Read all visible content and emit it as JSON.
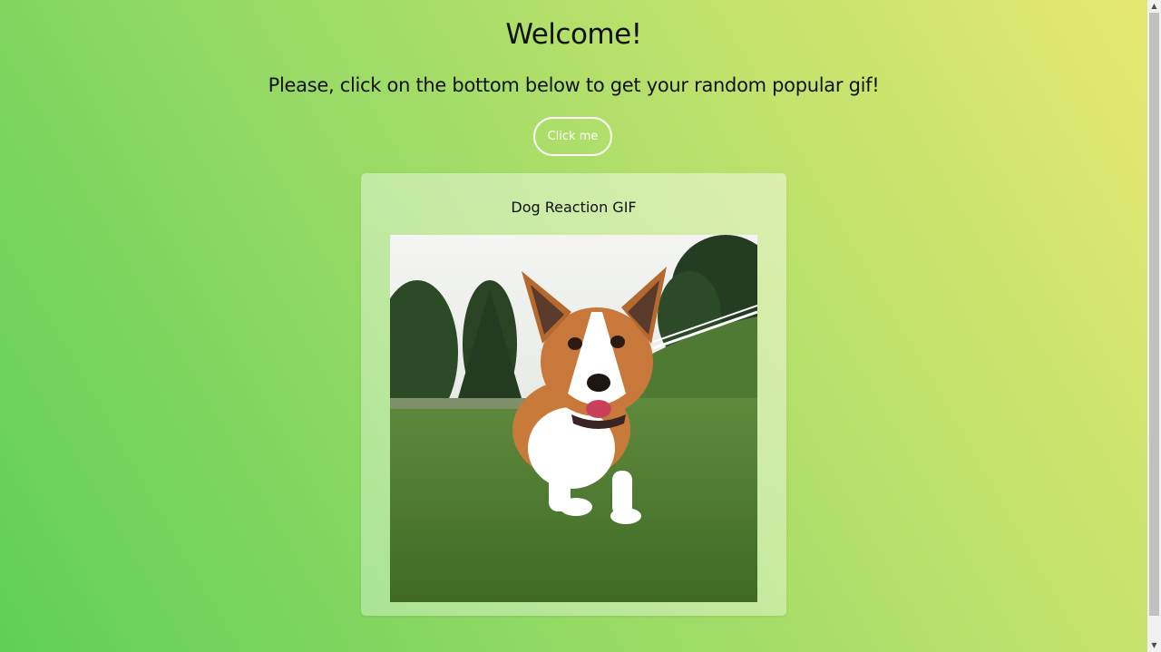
{
  "page": {
    "heading": "Welcome!",
    "subtitle": "Please, click on the bottom below to get your random popular gif!",
    "button_label": "Click me"
  },
  "gif_card": {
    "title": "Dog Reaction GIF",
    "image_subject": "corgi dog running on grass"
  },
  "scrollbar": {
    "up_icon": "▲",
    "down_icon": "▼"
  },
  "colors": {
    "gradient_start": "#5fcf56",
    "gradient_end": "#e6e870",
    "button_border": "#ffffff"
  }
}
